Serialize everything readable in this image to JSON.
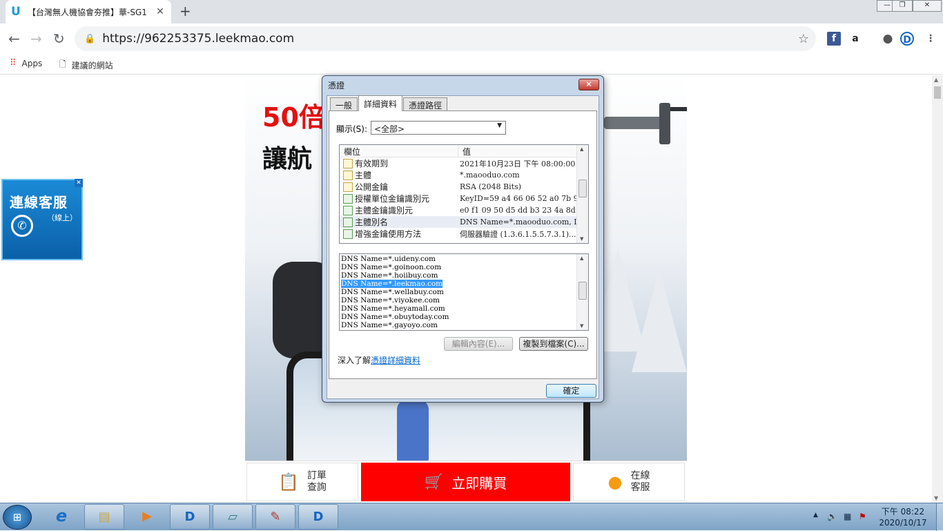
{
  "browser": {
    "tab_icon": "U",
    "tab_title": "【台灣無人機協會夯推】華-SG1",
    "tab_close": "✕",
    "new_tab": "+",
    "window_controls": [
      "—",
      "❐",
      "✕"
    ],
    "url": "https://962253375.leekmao.com",
    "bookmarks": [
      "Apps",
      "建議的網站"
    ]
  },
  "page": {
    "headline1": "50倍",
    "headline2": "讓航",
    "float_title": "連線客服",
    "float_sub": "（線上）",
    "bottom": {
      "order_label": "訂單\n查詢",
      "buy_label": "立即購買",
      "service_label": "在線\n客服"
    }
  },
  "dialog": {
    "title": "憑證",
    "close": "✕",
    "tabs": [
      "一般",
      "詳細資料",
      "憑證路徑"
    ],
    "active_tab": 1,
    "show_label": "顯示(S):",
    "show_value": "<全部>",
    "columns": [
      "欄位",
      "值"
    ],
    "fields": [
      {
        "name": "有效期到",
        "value": "2021年10月23日 下午 08:00:00",
        "icon": "cert-field-icon"
      },
      {
        "name": "主體",
        "value": "*.maooduo.com",
        "icon": "cert-field-icon"
      },
      {
        "name": "公開金鑰",
        "value": "RSA (2048 Bits)",
        "icon": "cert-field-icon"
      },
      {
        "name": "授權單位金鑰識別元",
        "value": "KeyID=59 a4 66 06 52 a0 7b 9...",
        "icon": "cert-extension-icon"
      },
      {
        "name": "主體金鑰識別元",
        "value": "e0 f1 09 50 d5 dd b3 23 4a 8d ...",
        "icon": "cert-extension-icon"
      },
      {
        "name": "主體別名",
        "value": "DNS Name=*.maooduo.com, D...",
        "icon": "cert-extension-icon"
      },
      {
        "name": "增強金鑰使用方法",
        "value": "伺服器驗證 (1.3.6.1.5.5.7.3.1)...",
        "icon": "cert-extension-icon"
      }
    ],
    "selected_field": 5,
    "dns_values": [
      "DNS Name=*.uideny.com",
      "DNS Name=*.goinoon.com",
      "DNS Name=*.hoiibuy.com",
      "DNS Name=*.leekmao.com",
      "DNS Name=*.wellabuy.com",
      "DNS Name=*.viyokee.com",
      "DNS Name=*.heyamall.com",
      "DNS Name=*.obuytoday.com",
      "DNS Name=*.gayoyo.com"
    ],
    "selected_dns": 3,
    "edit_button": "編輯內容(E)...",
    "copy_button": "複製到檔案(C)...",
    "learn_prefix": "深入了解",
    "learn_link": "憑證詳細資料",
    "ok_button": "確定"
  },
  "taskbar": {
    "start": "⊞",
    "clock_time": "下午 08:22",
    "clock_date": "2020/10/17"
  },
  "colors": {
    "buy_red": "#ff0000",
    "headline_red": "#e31111",
    "link_blue": "#0066cc",
    "selection_blue": "#3399ff"
  }
}
